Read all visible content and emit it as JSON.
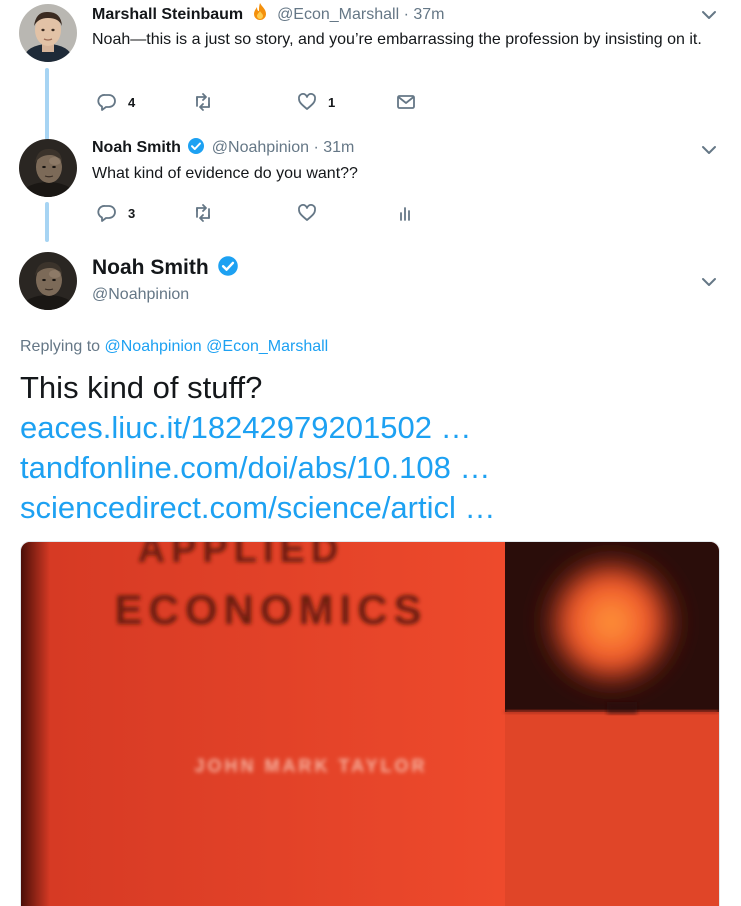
{
  "tweets": [
    {
      "name": "Marshall Steinbaum",
      "emoji": "fire-emoji",
      "handle": "@Econ_Marshall",
      "separator": "·",
      "time": "37m",
      "text": "Noah—this is a just so story, and you’re embarrassing the profession by insisting on it.",
      "reply_count": "4",
      "retweet_count": "",
      "like_count": "1",
      "extra_action": "mail-icon"
    },
    {
      "name": "Noah Smith",
      "verified": true,
      "handle": "@Noahpinion",
      "separator": "·",
      "time": "31m",
      "text": "What kind of evidence do you want??",
      "reply_count": "3",
      "retweet_count": "",
      "like_count": "",
      "extra_action": "analytics-icon"
    }
  ],
  "main_tweet": {
    "name": "Noah Smith",
    "verified": true,
    "handle": "@Noahpinion",
    "replying_prefix": "Replying to",
    "replying_to": [
      "@Noahpinion",
      "@Econ_Marshall"
    ],
    "text": "This kind of stuff?",
    "links": [
      "eaces.liuc.it/18242979201502 …",
      "tandfonline.com/doi/abs/10.108 …",
      "sciencedirect.com/science/articl …"
    ],
    "card": {
      "image_text_1": "APPLIED",
      "image_text_2": "ECONOMICS",
      "image_text_3": "JOHN MARK TAYLOR"
    }
  },
  "colors": {
    "accent": "#1da1f2",
    "thread_line": "#a7d4f3",
    "muted": "#657786",
    "card_red": "#e8432a"
  }
}
